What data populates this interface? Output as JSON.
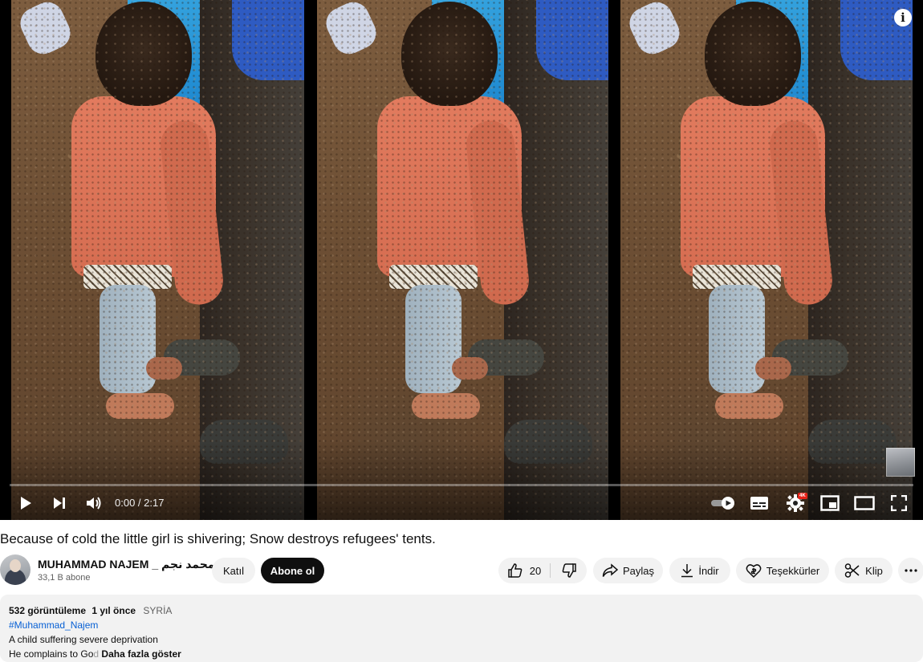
{
  "player": {
    "current_time": "0:00",
    "duration": "2:17",
    "time_display": "0:00 / 2:17",
    "hd_badge": "4K",
    "icons": [
      "info-icon",
      "play-icon",
      "next-icon",
      "volume-icon",
      "autoplay-toggle-icon",
      "subtitles-icon",
      "settings-icon",
      "miniplayer-icon",
      "theater-mode-icon",
      "fullscreen-icon"
    ]
  },
  "video": {
    "title": "Because of cold the little girl is shivering; Snow destroys refugees' tents."
  },
  "channel": {
    "name": "MUHAMMAD NAJEM _ محمد نجم",
    "subscribers": "33,1 B abone",
    "join_label": "Katıl",
    "subscribe_label": "Abone ol"
  },
  "actions": {
    "like_count": "20",
    "share_label": "Paylaş",
    "download_label": "İndir",
    "thanks_label": "Teşekkürler",
    "clip_label": "Klip"
  },
  "description": {
    "views": "532 görüntüleme",
    "age": "1 yıl önce",
    "location": "SYRİA",
    "hashtag": "#Muhammad_Najem",
    "line1": "A child suffering severe deprivation",
    "line2_prefix": "He complains to Go",
    "line2_faded": "d",
    "more_label": "Daha fazla göster"
  },
  "colors": {
    "subscribe_bg": "#0f0f0f",
    "button_bg": "#f2f2f2",
    "link": "#065fd4",
    "hd_badge": "#e62117"
  }
}
